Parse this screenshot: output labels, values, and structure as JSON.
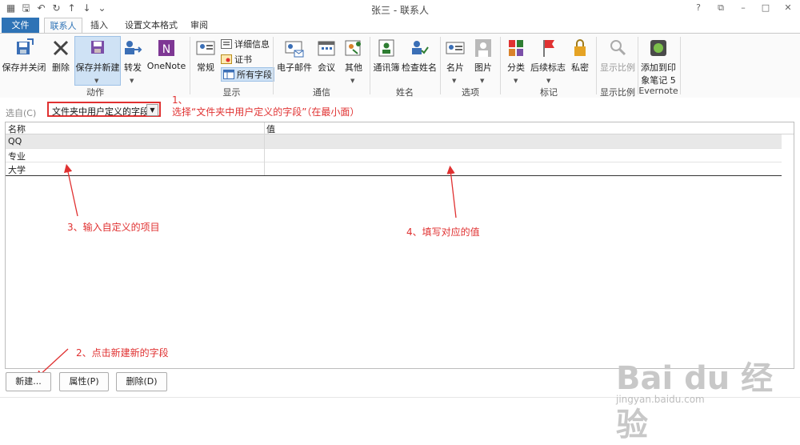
{
  "window": {
    "title": "张三 - 联系人",
    "help": "?",
    "restore_ribbon": "⧉",
    "minimize": "–",
    "maximize": "□",
    "close": "✕"
  },
  "qat": [
    "save-icon",
    "undo-icon",
    "redo-icon",
    "up-icon",
    "down-icon",
    "customize-icon"
  ],
  "tabs": {
    "file": "文件",
    "contacts": "联系人",
    "insert": "插入",
    "format": "设置文本格式",
    "review": "审阅"
  },
  "ribbon": {
    "save_close": "保存并关闭",
    "delete": "删除",
    "save_new": "保存并新建",
    "forward": "转发",
    "onenote": "OneNote",
    "group_actions": "动作",
    "general": "常规",
    "details": "详细信息",
    "certificates": "证书",
    "all_fields": "所有字段",
    "group_show": "显示",
    "email": "电子邮件",
    "meeting": "会议",
    "more": "其他",
    "group_communicate": "通信",
    "address_book": "通讯簿",
    "check_names": "检查姓名",
    "group_names": "姓名",
    "business_card": "名片",
    "picture": "图片",
    "group_options": "选项",
    "categorize": "分类",
    "follow_up": "后续标志",
    "private": "私密",
    "group_tags": "标记",
    "zoom": "显示比例",
    "group_zoom": "显示比例",
    "evernote_line1": "添加到印",
    "evernote_line2": "象笔记 5",
    "group_evernote": "Evernote"
  },
  "select": {
    "label": "选自(C)",
    "value": "文件夹中用户定义的字段"
  },
  "annotations": {
    "a1_num": "1、",
    "a1_text": "选择“文件夹中用户定义的字段”（在最小面）",
    "a2": "2、点击新建新的字段",
    "a3": "3、输入自定义的项目",
    "a4": "4、填写对应的值"
  },
  "table": {
    "headers": [
      "名称",
      "值"
    ],
    "rows": [
      {
        "name": "QQ",
        "value": ""
      },
      {
        "name": "专业",
        "value": ""
      },
      {
        "name": "大学",
        "value": ""
      }
    ]
  },
  "buttons": {
    "new": "新建...",
    "properties": "属性(P)",
    "delete": "删除(D)"
  },
  "watermark": {
    "logo": "Bai du 经验",
    "url": "jingyan.baidu.com"
  },
  "colors": {
    "accent": "#2e73b6",
    "annotation": "#e03131"
  }
}
